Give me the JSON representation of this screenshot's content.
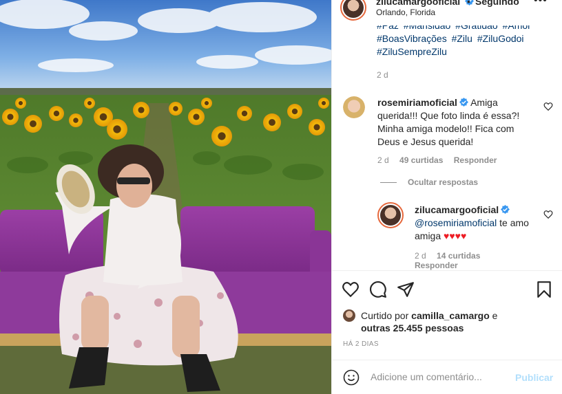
{
  "post": {
    "username": "zilucamargooficial",
    "dot": "•",
    "follow_status": "Seguindo",
    "location": "Orlando, Florida",
    "more_icon": "more-horizontal-icon",
    "hashtags_partial": [
      "#Paz",
      "#Mansidão",
      "#Gratidão",
      "#Amor"
    ],
    "hashtags": [
      "#BoasVibrações",
      "#Zilu",
      "#ZiluGodoi",
      "#ZiluSempreZilu"
    ],
    "time": "2 d"
  },
  "comment": {
    "username": "rosemiriamoficial",
    "text": "Amiga querida!!! Que foto linda é essa?! Minha amiga modelo!! Fica com Deus e Jesus querida!",
    "time": "2 d",
    "likes": "49 curtidas",
    "reply_label": "Responder",
    "hide_replies": "Ocultar respostas"
  },
  "reply": {
    "username": "zilucamargooficial",
    "mention": "@rosemiriamoficial",
    "text": "te amo amiga",
    "hearts": "♥♥♥♥",
    "time": "2 d",
    "likes": "14 curtidas",
    "reply_label": "Responder"
  },
  "actions": {
    "liked_prefix": "Curtido por",
    "liked_user": "camilla_camargo",
    "liked_and": "e",
    "liked_others": "outras 25.455 pessoas",
    "posted": "HÁ 2 DIAS"
  },
  "add_comment": {
    "placeholder": "Adicione um comentário...",
    "publish_label": "Publicar"
  },
  "colors": {
    "link": "#00376b",
    "muted": "#8e8e8e",
    "verified": "#3897f0",
    "publish_disabled": "#b2dffc",
    "heart": "#ed1c24"
  }
}
